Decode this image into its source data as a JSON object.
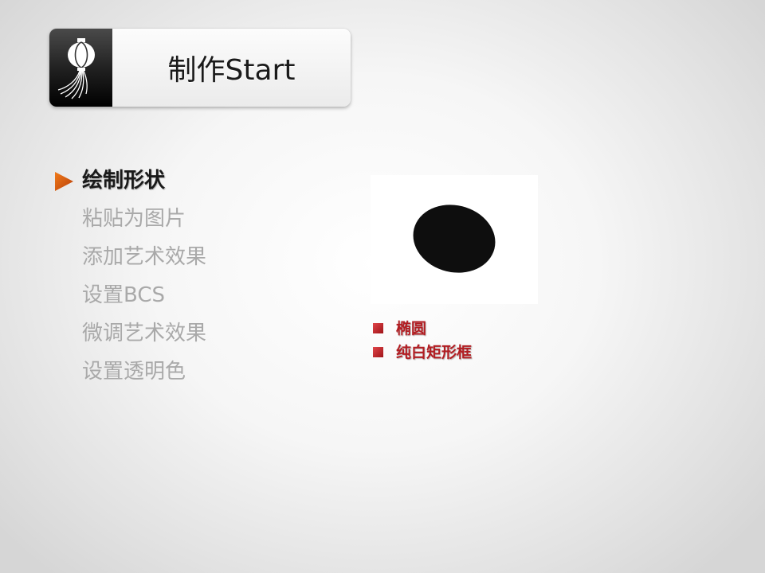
{
  "title": "制作Start",
  "menu": [
    {
      "label": "绘制形状",
      "active": true
    },
    {
      "label": "粘贴为图片",
      "active": false
    },
    {
      "label": "添加艺术效果",
      "active": false
    },
    {
      "label": "设置BCS",
      "active": false
    },
    {
      "label": "微调艺术效果",
      "active": false
    },
    {
      "label": "设置透明色",
      "active": false
    }
  ],
  "bullets": [
    "椭圆",
    "纯白矩形框"
  ],
  "colors": {
    "accent_red": "#b21d22",
    "arrow_orange": "#d9560b",
    "active_text": "#1a1a1a",
    "inactive_text": "#a9a9a9",
    "ellipse_fill": "#0e0e0e"
  },
  "icons": {
    "logo": "lantern-icon",
    "current_marker": "triangle-arrow-icon",
    "bullet": "red-square-icon"
  }
}
